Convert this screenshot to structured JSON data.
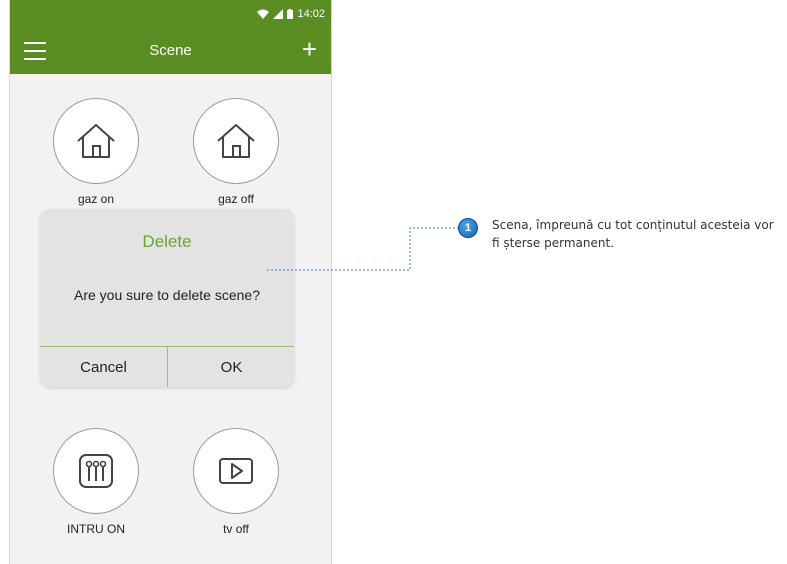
{
  "status_bar": {
    "time": "14:02"
  },
  "toolbar": {
    "title": "Scene",
    "add_label": "+"
  },
  "scenes": [
    {
      "label": "gaz on",
      "icon": "home-icon"
    },
    {
      "label": "gaz off",
      "icon": "home-icon"
    },
    {
      "label": "INTRU ON",
      "icon": "sliders-icon"
    },
    {
      "label": "tv off",
      "icon": "play-icon"
    }
  ],
  "dialog": {
    "title": "Delete",
    "message": "Are you sure to delete scene?",
    "cancel_label": "Cancel",
    "ok_label": "OK"
  },
  "annotation": {
    "marker": "1",
    "text": "Scena, împreună cu tot conținutul acesteia vor fi șterse permanent."
  },
  "colors": {
    "brand_green": "#5a8e22",
    "dialog_title": "#6ba42d",
    "marker_blue": "#1e78cc"
  }
}
